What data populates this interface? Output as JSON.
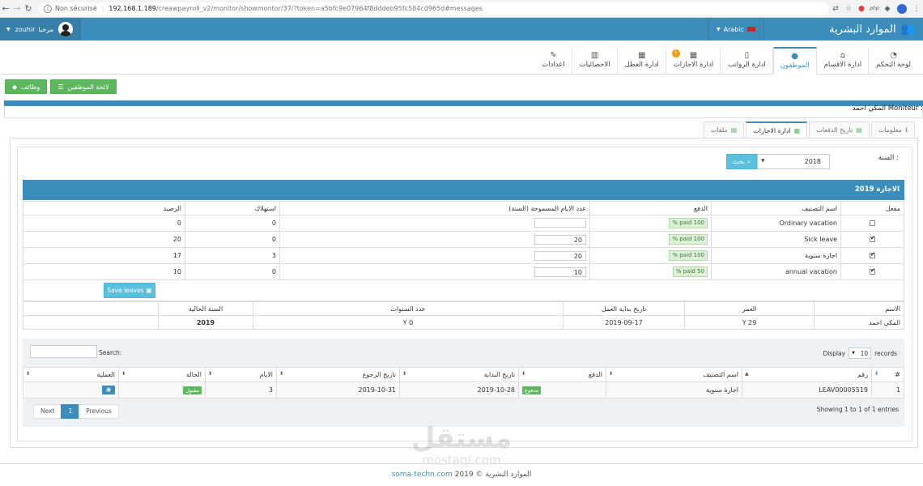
{
  "browser": {
    "insecure_label": "Non sécurisé",
    "host": "192.168.1.189",
    "path": "/creawpayroll_v2/monitor/showmontor/37/?token=a5bfc9e07964f8dddeb95fc584cd965d#messages",
    "ext_php": "php"
  },
  "header": {
    "brand": "الموارد البشرية",
    "language": "Arabic",
    "greeting": "مرحبا",
    "username": "zouhir"
  },
  "modules": [
    {
      "label": "لوحة التحكم",
      "icon": "dashboard-icon",
      "glyph": "◔"
    },
    {
      "label": "ادارة الاقسام",
      "icon": "home-icon",
      "glyph": "⌂"
    },
    {
      "label": "الموظفون",
      "icon": "user-icon",
      "glyph": "●"
    },
    {
      "label": "ادارة الرواتب",
      "icon": "mobile-icon",
      "glyph": "▯"
    },
    {
      "label": "ادارة الاجازات",
      "icon": "calendar-icon",
      "glyph": "▦",
      "badge": "!"
    },
    {
      "label": "ادارة العطل",
      "icon": "calendar-grid-icon",
      "glyph": "▦"
    },
    {
      "label": "الاحصائيات",
      "icon": "bar-chart-icon",
      "glyph": "▥"
    },
    {
      "label": "اعدادات",
      "icon": "wrench-icon",
      "glyph": "✎"
    }
  ],
  "actions": {
    "employees_list": "لائحة الموظفين",
    "jobs": "وظائف"
  },
  "page": {
    "title_prefix": "Moniteur :",
    "employee_name": "المكي احمد"
  },
  "tabs": [
    {
      "label": "معلومات",
      "icon": "info-icon",
      "glyph": "ℹ"
    },
    {
      "label": "تاريخ الدفعات",
      "icon": "file-icon",
      "glyph": "▤"
    },
    {
      "label": "ادارة الاجازات",
      "icon": "calendar-icon",
      "glyph": "▦"
    },
    {
      "label": "ملفات",
      "icon": "file-green-icon",
      "glyph": "▤"
    }
  ],
  "filter": {
    "year_label": "السنة :",
    "year_value": "2018",
    "search_label": "بحث"
  },
  "leaves": {
    "title": "الاجازة 2019",
    "headers": {
      "enabled": "مفعل",
      "category": "اسم التصنيف",
      "payment": "الدفع",
      "allowed_days": "عدد الايام المسموحة (السنة)",
      "consumption": "استهلاك",
      "balance": "الرصيد"
    },
    "rows": [
      {
        "enabled": false,
        "category": "Ordinary vacation",
        "paid": "100 paid %",
        "days": "",
        "used": "0",
        "balance": "0"
      },
      {
        "enabled": true,
        "category": "Sick leave",
        "paid": "100 paid %",
        "days": "20",
        "used": "0",
        "balance": "20"
      },
      {
        "enabled": true,
        "category": "اجازة سنوية",
        "paid": "100 paid %",
        "days": "20",
        "used": "3",
        "balance": "17"
      },
      {
        "enabled": true,
        "category": "annual vacation",
        "paid": "50 paid %",
        "days": "10",
        "used": "0",
        "balance": "10"
      }
    ],
    "save_label": "Save leaves"
  },
  "summary": {
    "headers": {
      "name": "الاسم",
      "age": "العمر",
      "start_date": "تاريخ بداية العمل",
      "years": "عدد السنوات",
      "current_year": "السنة الحالية"
    },
    "values": {
      "name": "المكي احمد",
      "age": "29 Y",
      "start_date": "2019-09-17",
      "years": "0 Y",
      "current_year": "2019"
    }
  },
  "datatable": {
    "search_label": "Search:",
    "display_label": "Display",
    "records_label": "records",
    "length": "10",
    "headers": [
      "#",
      "رقم",
      "اسم التصنيف",
      "الدفع",
      "تاريخ البداية",
      "تاريخ الرجوع",
      "الايام",
      "الحالة",
      "العملية"
    ],
    "rows": [
      {
        "num": "1",
        "ref": "LEAV00005519",
        "category": "اجازة سنوية",
        "payment": "مدفوع",
        "start": "2019-10-28",
        "return": "2019-10-31",
        "days": "3",
        "status": "مقبول"
      }
    ],
    "pager": {
      "previous": "Previous",
      "current": "1",
      "next": "Next"
    },
    "info": "Showing 1 to 1 of 1 entries"
  },
  "footer": {
    "text": "الموارد البشرية © 2019",
    "link": "soma-techn.com"
  },
  "watermark": {
    "arabic": "مستقل",
    "latin": "mostaql.com"
  },
  "colors": {
    "primary": "#3c8dbc",
    "success": "#5cb85c",
    "info": "#5bc0de"
  }
}
